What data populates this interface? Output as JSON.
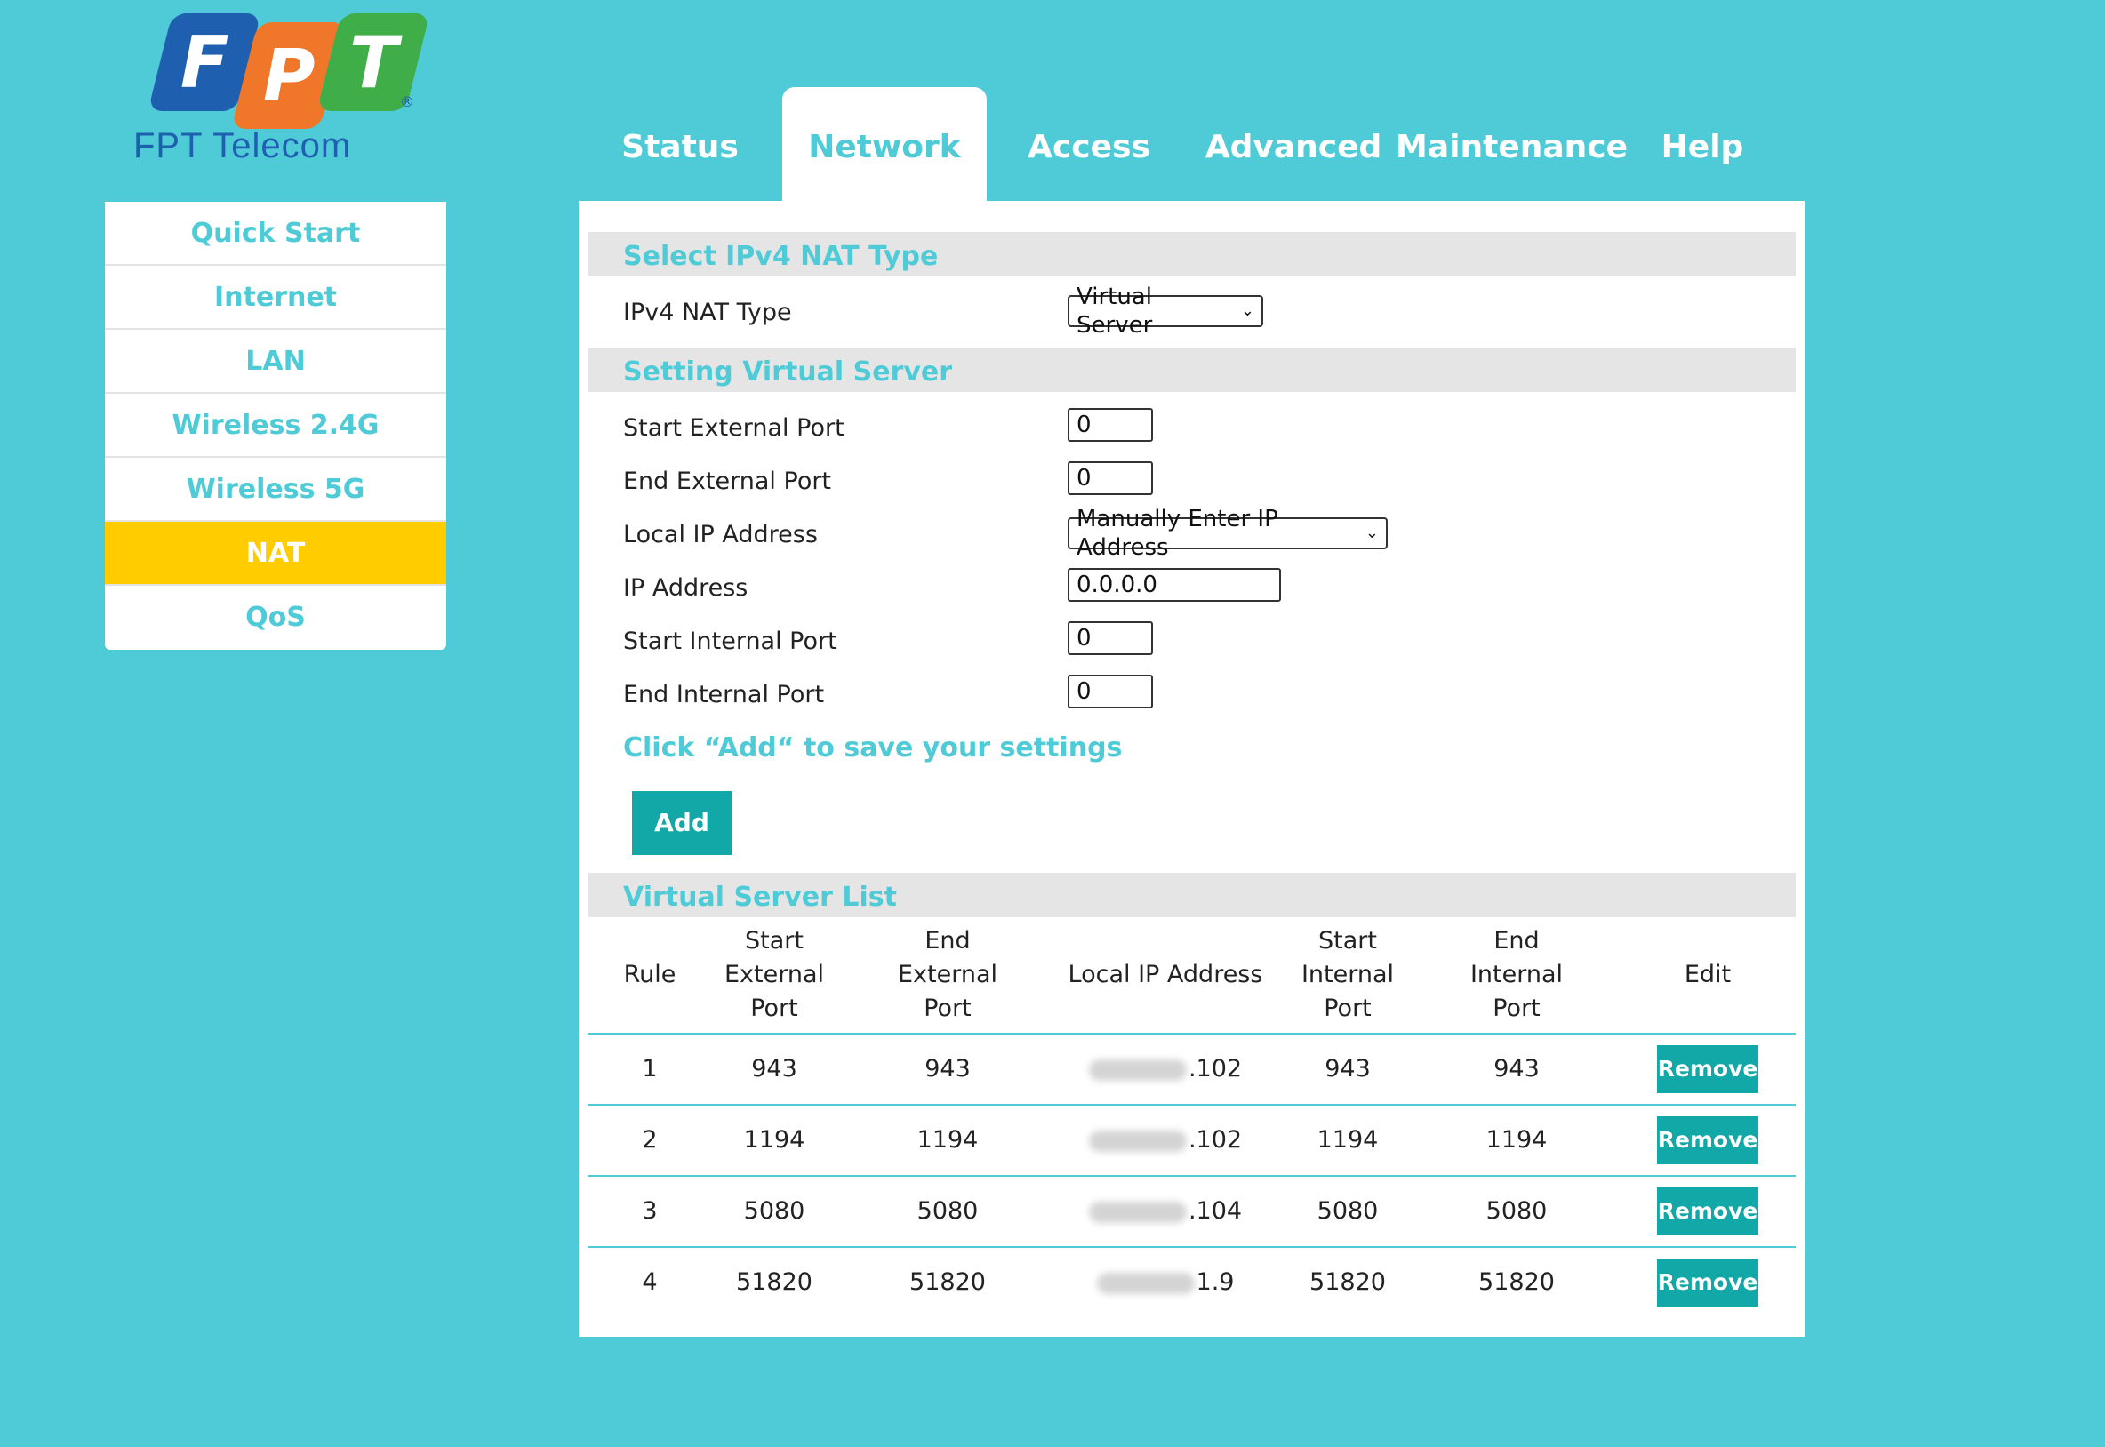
{
  "logo": {
    "letters": [
      "F",
      "P",
      "T"
    ],
    "brand": "FPT Telecom"
  },
  "tabs": [
    {
      "label": "Status"
    },
    {
      "label": "Network"
    },
    {
      "label": "Access"
    },
    {
      "label": "Advanced"
    },
    {
      "label": "Maintenance"
    },
    {
      "label": "Help"
    }
  ],
  "sidebar": {
    "items": [
      {
        "label": "Quick Start"
      },
      {
        "label": "Internet"
      },
      {
        "label": "LAN"
      },
      {
        "label": "Wireless 2.4G"
      },
      {
        "label": "Wireless 5G"
      },
      {
        "label": "NAT"
      },
      {
        "label": "QoS"
      }
    ]
  },
  "nat_type": {
    "heading": "Select IPv4 NAT Type",
    "label": "IPv4 NAT Type",
    "value": "Virtual Server"
  },
  "virtual_server": {
    "heading": "Setting Virtual Server",
    "start_external_port": {
      "label": "Start External Port",
      "value": "0"
    },
    "end_external_port": {
      "label": "End External Port",
      "value": "0"
    },
    "local_ip": {
      "label": "Local IP Address",
      "value": "Manually Enter IP Address"
    },
    "ip_address": {
      "label": "IP Address",
      "value": "0.0.0.0"
    },
    "start_internal_port": {
      "label": "Start Internal Port",
      "value": "0"
    },
    "end_internal_port": {
      "label": "End Internal Port",
      "value": "0"
    },
    "hint": "Click “Add“ to save your settings",
    "add_label": "Add"
  },
  "list": {
    "heading": "Virtual Server List",
    "columns": {
      "rule": "Rule",
      "start_ext": [
        "Start",
        "External",
        "Port"
      ],
      "end_ext": [
        "End",
        "External",
        "Port"
      ],
      "local_ip": "Local IP Address",
      "start_int": [
        "Start",
        "Internal",
        "Port"
      ],
      "end_int": [
        "End",
        "Internal",
        "Port"
      ],
      "edit": "Edit"
    },
    "remove_label": "Remove",
    "rows": [
      {
        "rule": "1",
        "start_ext": "943",
        "end_ext": "943",
        "ip_suffix": ".102",
        "start_int": "943",
        "end_int": "943"
      },
      {
        "rule": "2",
        "start_ext": "1194",
        "end_ext": "1194",
        "ip_suffix": ".102",
        "start_int": "1194",
        "end_int": "1194"
      },
      {
        "rule": "3",
        "start_ext": "5080",
        "end_ext": "5080",
        "ip_suffix": ".104",
        "start_int": "5080",
        "end_int": "5080"
      },
      {
        "rule": "4",
        "start_ext": "51820",
        "end_ext": "51820",
        "ip_suffix": "1.9",
        "start_int": "51820",
        "end_int": "51820"
      }
    ]
  }
}
